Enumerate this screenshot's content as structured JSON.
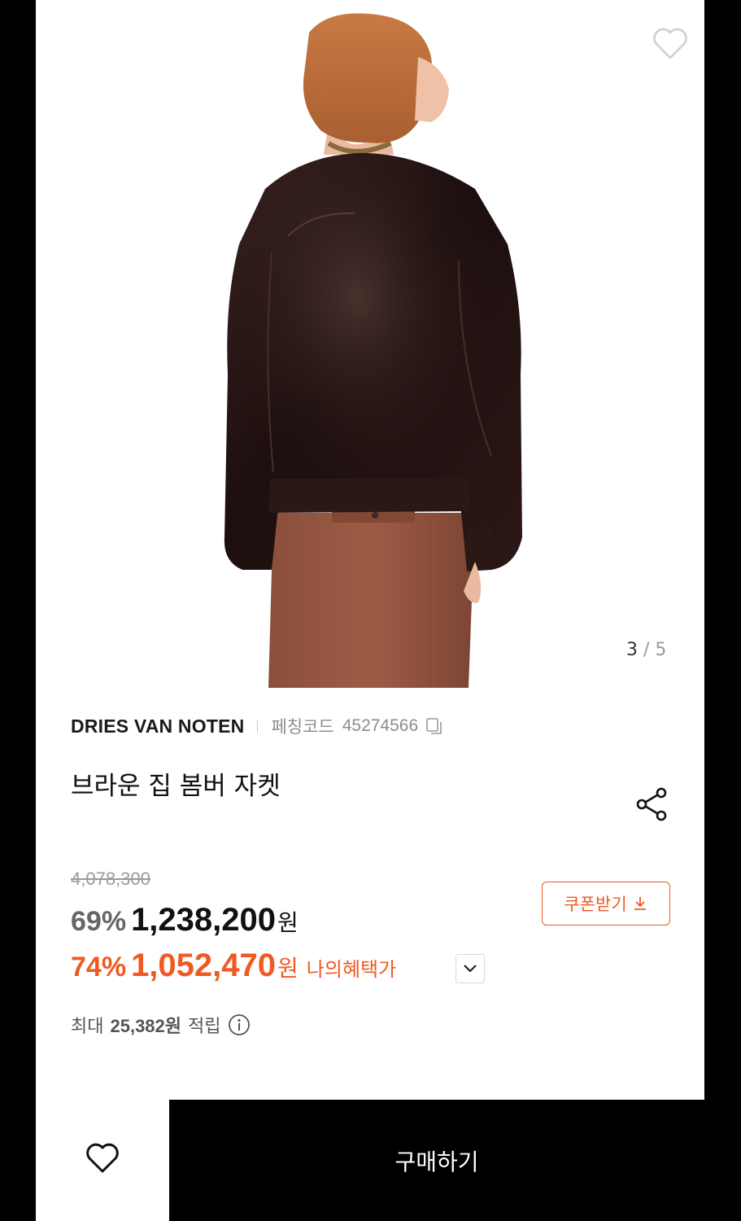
{
  "product": {
    "brand": "DRIES VAN NOTEN",
    "code_label": "페칭코드",
    "code": "45274566",
    "title": "브라운 집 봄버 자켓"
  },
  "gallery": {
    "current": "3",
    "separator": "/",
    "total": "5"
  },
  "pricing": {
    "original": "4,078,300",
    "discount1_pct": "69%",
    "discount1_price": "1,238,200",
    "currency": "원",
    "discount2_pct": "74%",
    "discount2_price": "1,052,470",
    "benefit_label": "나의혜택가"
  },
  "coupon": {
    "label": "쿠폰받기"
  },
  "points": {
    "prefix": "최대",
    "value": "25,382원",
    "suffix": "적립"
  },
  "actions": {
    "buy_label": "구매하기"
  },
  "colors": {
    "accent": "#f05a22",
    "buy_bg": "#000000"
  },
  "icons": [
    "heart-icon",
    "copy-icon",
    "share-icon",
    "chevron-down-icon",
    "download-icon",
    "info-icon"
  ]
}
